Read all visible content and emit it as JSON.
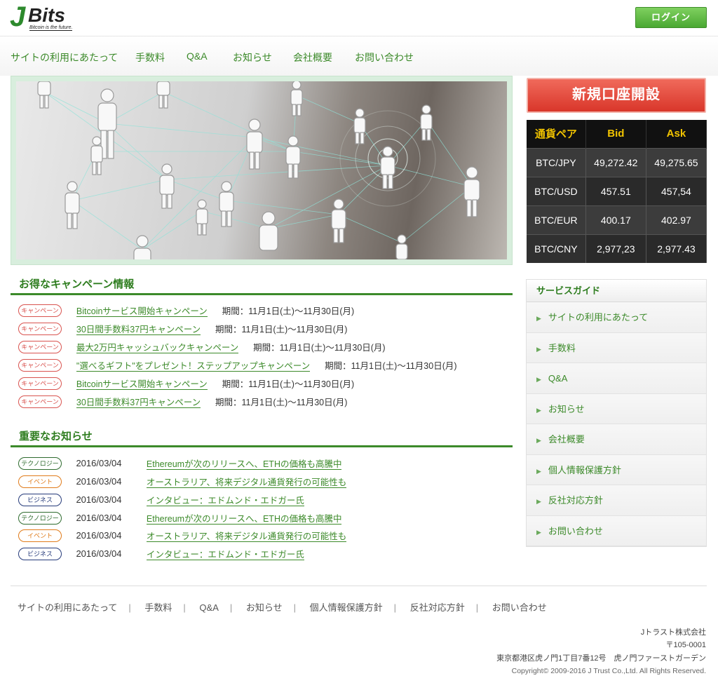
{
  "header": {
    "logo_letter": "J",
    "logo_word": "Bits",
    "logo_tagline": "Bitcoin is the future.",
    "login_label": "ログイン"
  },
  "nav": [
    "サイトの利用にあたって",
    "手数料",
    "Q&A",
    "お知らせ",
    "会社概要",
    "お問い合わせ"
  ],
  "open_account_label": "新規口座開設",
  "rates": {
    "headers": [
      "通貨ペア",
      "Bid",
      "Ask"
    ],
    "rows": [
      [
        "BTC/JPY",
        "49,272.42",
        "49,275.65"
      ],
      [
        "BTC/USD",
        "457.51",
        "457,54"
      ],
      [
        "BTC/EUR",
        "400.17",
        "402.97"
      ],
      [
        "BTC/CNY",
        "2,977,23",
        "2,977.43"
      ]
    ]
  },
  "campaigns": {
    "title": "お得なキャンペーン情報",
    "badge": "キャンペーン",
    "items": [
      {
        "title": "Bitcoinサービス開始キャンペーン",
        "period": "期間：11月1日(土)〜11月30日(月)"
      },
      {
        "title": "30日間手数料37円キャンペーン",
        "period": "期間：11月1日(土)〜11月30日(月)"
      },
      {
        "title": "最大2万円キャッシュバックキャンペーン",
        "period": "期間：11月1日(土)〜11月30日(月)"
      },
      {
        "title": "\"選べるギフト\"をプレゼント！ステップアップキャンペーン",
        "period": "期間：11月1日(土)〜11月30日(月)"
      },
      {
        "title": "Bitcoinサービス開始キャンペーン",
        "period": "期間：11月1日(土)〜11月30日(月)"
      },
      {
        "title": "30日間手数料37円キャンペーン",
        "period": "期間：11月1日(土)〜11月30日(月)"
      }
    ]
  },
  "news": {
    "title": "重要なお知らせ",
    "items": [
      {
        "category": "テクノロジー",
        "type": "tech",
        "date": "2016/03/04",
        "title": "Ethereumが次のリリースへ、ETHの価格も高騰中"
      },
      {
        "category": "イベント",
        "type": "event",
        "date": "2016/03/04",
        "title": "オーストラリア、将来デジタル通貨発行の可能性も"
      },
      {
        "category": "ビジネス",
        "type": "biz",
        "date": "2016/03/04",
        "title": "インタビュー：エドムンド・エドガー氏"
      },
      {
        "category": "テクノロジー",
        "type": "tech",
        "date": "2016/03/04",
        "title": "Ethereumが次のリリースへ、ETHの価格も高騰中"
      },
      {
        "category": "イベント",
        "type": "event",
        "date": "2016/03/04",
        "title": "オーストラリア、将来デジタル通貨発行の可能性も"
      },
      {
        "category": "ビジネス",
        "type": "biz",
        "date": "2016/03/04",
        "title": "インタビュー：エドムンド・エドガー氏"
      }
    ]
  },
  "guide": {
    "title": "サービスガイド",
    "items": [
      "サイトの利用にあたって",
      "手数料",
      "Q&A",
      "お知らせ",
      "会社概要",
      "個人情報保護方針",
      "反社対応方針",
      "お問い合わせ"
    ]
  },
  "footer": {
    "nav": [
      "サイトの利用にあたって",
      "手数料",
      "Q&A",
      "お知らせ",
      "個人情報保護方針",
      "反社対応方針",
      "お問い合わせ"
    ],
    "company": "Jトラスト株式会社",
    "postal": "〒105-0001",
    "address": "東京都港区虎ノ門1丁目7番12号　虎ノ門ファーストガーデン",
    "copyright": "Copyright© 2009-2016 J Trust Co.,Ltd. All Rights Reserved."
  },
  "colors": {
    "brand_green": "#3c8a2a",
    "login_green": "#5cb83f",
    "open_red": "#e04a3c",
    "rate_header_yellow": "#f2c400"
  }
}
